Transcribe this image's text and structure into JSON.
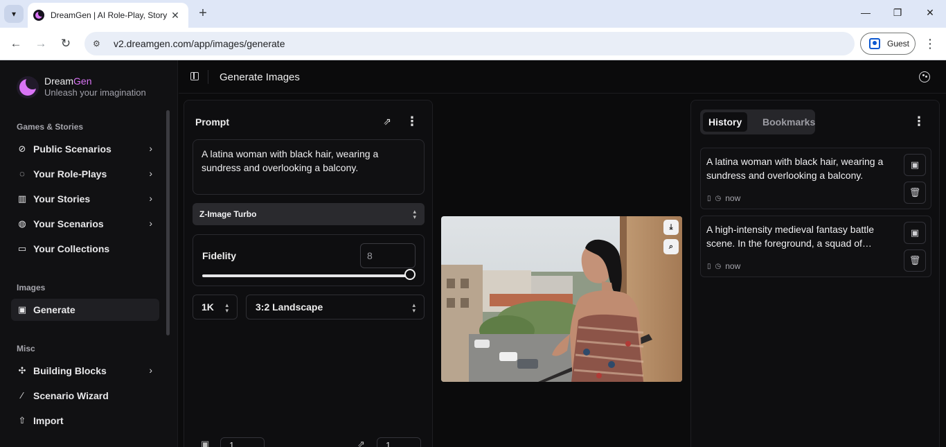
{
  "browser": {
    "tab_title": "DreamGen | AI Role-Play, Story",
    "url": "v2.dreamgen.com/app/images/generate",
    "profile_label": "Guest"
  },
  "brand": {
    "name_part1": "Dream",
    "name_part2": "Gen",
    "tagline": "Unleash your imagination",
    "accent_color": "#d974f5"
  },
  "sidebar": {
    "sections": [
      {
        "label": "Games & Stories"
      },
      {
        "label": "Images"
      },
      {
        "label": "Misc"
      }
    ],
    "items": [
      {
        "label": "Public Scenarios",
        "icon": "compass-icon",
        "has_chevron": true
      },
      {
        "label": "Your Role-Plays",
        "icon": "chat-bubble-icon",
        "has_chevron": true
      },
      {
        "label": "Your Stories",
        "icon": "book-icon",
        "has_chevron": true
      },
      {
        "label": "Your Scenarios",
        "icon": "globe-icon",
        "has_chevron": true
      },
      {
        "label": "Your Collections",
        "icon": "folder-icon",
        "has_chevron": false
      },
      {
        "label": "Generate",
        "icon": "image-stack-icon",
        "has_chevron": false,
        "active": true
      },
      {
        "label": "Building Blocks",
        "icon": "puzzle-icon",
        "has_chevron": true
      },
      {
        "label": "Scenario Wizard",
        "icon": "magic-wand-icon",
        "has_chevron": false
      },
      {
        "label": "Import",
        "icon": "upload-icon",
        "has_chevron": false
      }
    ]
  },
  "header": {
    "title": "Generate Images"
  },
  "prompt_panel": {
    "title": "Prompt",
    "prompt_text": "A latina woman with black hair, wearing a sundress and overlooking a balcony.",
    "model": "Z-Image Turbo",
    "fidelity_label": "Fidelity",
    "fidelity_value": "8",
    "fidelity_fraction": 1.0,
    "resolution": "1K",
    "aspect_ratio": "3:2 Landscape",
    "image_count": "1",
    "variation_count": "1"
  },
  "history_panel": {
    "tabs": [
      {
        "label": "History",
        "active": true
      },
      {
        "label": "Bookmarks",
        "active": false
      }
    ],
    "items": [
      {
        "text": "A latina woman with black hair, wearing a sundress and overlooking a balcony.",
        "time": "now"
      },
      {
        "text": "A high-intensity medieval fantasy battle scene. In the foreground, a squad of…",
        "time": "now"
      }
    ]
  }
}
